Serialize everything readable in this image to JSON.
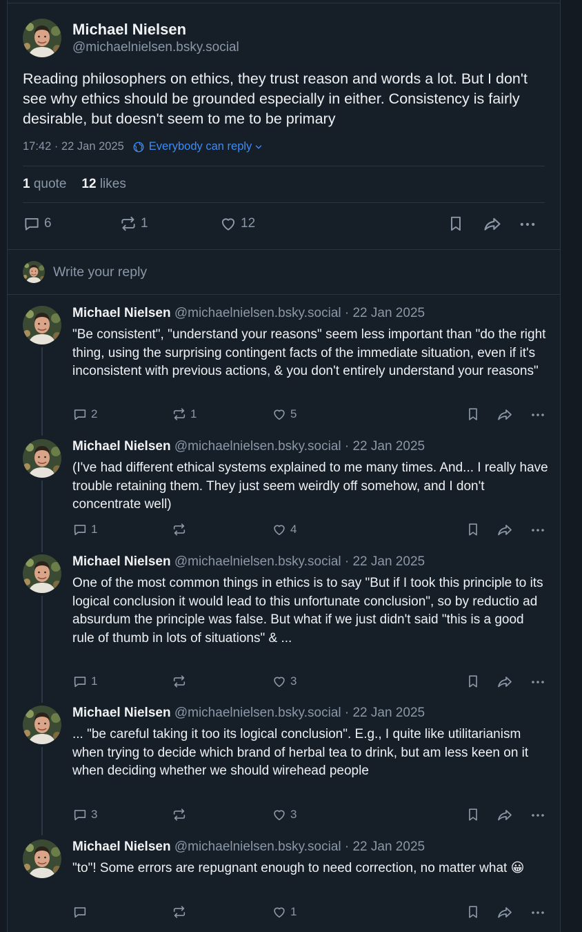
{
  "post": {
    "author_name": "Michael Nielsen",
    "author_handle": "@michaelnielsen.bsky.social",
    "text": "Reading philosophers on ethics, they trust reason and words a lot.  But I don't see why ethics should be grounded especially in either.  Consistency is fairly desirable, but doesn't seem to me to be primary",
    "timestamp": "17:42 · 22 Jan 2025",
    "reply_setting": "Everybody can reply",
    "quotes_count": "1",
    "quotes_label": "quote",
    "likes_count": "12",
    "likes_label": "likes",
    "reply_count": "6",
    "repost_count": "1",
    "like_count": "12"
  },
  "composer": {
    "placeholder": "Write your reply"
  },
  "replies": [
    {
      "author_name": "Michael Nielsen",
      "handle_date": "@michaelnielsen.bsky.social · 22 Jan 2025",
      "text": "\"Be consistent\", \"understand your reasons\" seem less important than \"do the right thing, using the surprising contingent facts of the immediate situation, even if it's inconsistent with previous actions, & you don't entirely understand your reasons\"",
      "replies": "2",
      "reposts": "1",
      "likes": "5"
    },
    {
      "author_name": "Michael Nielsen",
      "handle_date": "@michaelnielsen.bsky.social · 22 Jan 2025",
      "text": "(I've had different ethical systems explained to me many times. And... I really have trouble retaining them.  They just seem weirdly off somehow, and I don't concentrate well)",
      "replies": "1",
      "reposts": "",
      "likes": "4"
    },
    {
      "author_name": "Michael Nielsen",
      "handle_date": "@michaelnielsen.bsky.social · 22 Jan 2025",
      "text": "One of the most common things in ethics is to say \"But if I took this principle to its logical conclusion it would lead to this unfortunate conclusion\", so by reductio ad absurdum the principle was false.  But what if we just didn't said \"this is a good rule of thumb in lots of situations\" & ...",
      "replies": "1",
      "reposts": "",
      "likes": "3"
    },
    {
      "author_name": "Michael Nielsen",
      "handle_date": "@michaelnielsen.bsky.social · 22 Jan 2025",
      "text": "... \"be careful taking it too its logical conclusion\". E.g., I quite like utilitarianism when trying to decide which brand of herbal tea to drink, but am less keen on it when deciding whether we should wirehead people",
      "replies": "3",
      "reposts": "",
      "likes": "3"
    },
    {
      "author_name": "Michael Nielsen",
      "handle_date": "@michaelnielsen.bsky.social · 22 Jan 2025",
      "text": "\"to\"!  Some errors are repugnant enough to need correction, no matter what 😀",
      "replies": "",
      "reposts": "",
      "likes": "1"
    }
  ],
  "colors": {
    "background": "#161e27",
    "accent": "#3e8cf5",
    "muted": "#8b98a8",
    "divider": "#2a3542"
  },
  "icons": [
    "comment-icon",
    "repost-icon",
    "heart-icon",
    "bookmark-icon",
    "share-icon",
    "more-icon",
    "globe-icon",
    "chevron-down-icon"
  ]
}
